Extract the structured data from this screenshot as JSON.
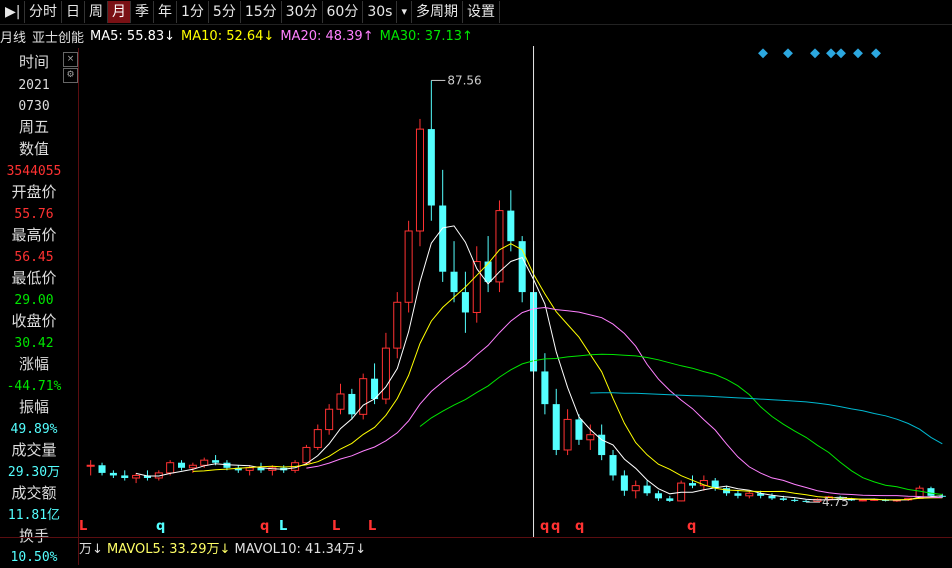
{
  "toolbar": {
    "icon_label": "▶|",
    "items": [
      "分时",
      "日",
      "周",
      "月",
      "季",
      "年",
      "1分",
      "5分",
      "15分",
      "30分",
      "60分",
      "30s",
      "▾",
      "多周期",
      "设置"
    ],
    "active": "月"
  },
  "info": {
    "period": "月线",
    "name": "亚士创能",
    "ma5": "MA5: 55.83↓",
    "ma10": "MA10: 52.64↓",
    "ma20": "MA20: 48.39↑",
    "ma30": "MA30: 37.13↑"
  },
  "sidebar": {
    "time_label": "时间",
    "year": "2021",
    "date": "0730",
    "weekday": "周五",
    "value_label": "数值",
    "value": "3544055",
    "open_label": "开盘价",
    "open": "55.76",
    "high_label": "最高价",
    "high": "56.45",
    "low_label": "最低价",
    "low": "29.00",
    "close_label": "收盘价",
    "close": "30.42",
    "change_label": "涨幅",
    "change": "-44.71%",
    "amplitude_label": "振幅",
    "amplitude": "49.89%",
    "volume_label": "成交量",
    "volume": "29.30万",
    "amount_label": "成交额",
    "amount": "11.81亿",
    "turnover_label": "换手",
    "turnover": "10.50%"
  },
  "annotations": {
    "high_price": "87.56",
    "low_price": "4.75"
  },
  "volume_bar": {
    "unit": "万↓",
    "mavol5": "MAVOL5: 33.29万↓",
    "mavol10": "MAVOL10: 41.34万↓"
  },
  "markers": [
    "L",
    "q",
    "q",
    "L",
    "L",
    "L",
    "q",
    "q",
    "q",
    "q"
  ],
  "colors": {
    "up": "#ff3232",
    "down": "#54ffff",
    "ma5": "#ffffff",
    "ma10": "#ffff00",
    "ma20": "#ff80ff",
    "ma30": "#00e600",
    "ma60": "#00b8d0",
    "accent": "#7a1014"
  },
  "chart_data": {
    "type": "candlestick",
    "period": "monthly",
    "ylim": [
      4,
      90
    ],
    "candles": [
      [
        12,
        13,
        10,
        12
      ],
      [
        12,
        12.5,
        10,
        10.5
      ],
      [
        10.5,
        11,
        9.5,
        10
      ],
      [
        10,
        11,
        9,
        9.5
      ],
      [
        9.5,
        10.5,
        8.5,
        10
      ],
      [
        10,
        11,
        9,
        9.5
      ],
      [
        9.5,
        11,
        9,
        10.5
      ],
      [
        10.5,
        13,
        10,
        12.5
      ],
      [
        12.5,
        13,
        11,
        11.5
      ],
      [
        11.5,
        12.5,
        10.5,
        12
      ],
      [
        12,
        13.5,
        11.5,
        13
      ],
      [
        13,
        14,
        12,
        12.5
      ],
      [
        12.5,
        13,
        11,
        11.5
      ],
      [
        11.5,
        12,
        10.5,
        11
      ],
      [
        11,
        12,
        10,
        11.5
      ],
      [
        11.5,
        12.5,
        10.5,
        11
      ],
      [
        11,
        12,
        10,
        11.5
      ],
      [
        11.5,
        12,
        10.5,
        11
      ],
      [
        11,
        13,
        10.5,
        12.5
      ],
      [
        12.5,
        16,
        12,
        15.5
      ],
      [
        15.5,
        20,
        15,
        19
      ],
      [
        19,
        24,
        18,
        23
      ],
      [
        23,
        28,
        22,
        26
      ],
      [
        26,
        27,
        21,
        22
      ],
      [
        22,
        30,
        21,
        29
      ],
      [
        29,
        32,
        24,
        25
      ],
      [
        25,
        38,
        24,
        35
      ],
      [
        35,
        46,
        33,
        44
      ],
      [
        44,
        60,
        42,
        58
      ],
      [
        58,
        80,
        55,
        78
      ],
      [
        78,
        87.56,
        60,
        63
      ],
      [
        63,
        70,
        48,
        50
      ],
      [
        50,
        56,
        44,
        46
      ],
      [
        46,
        50,
        38,
        42
      ],
      [
        42,
        55,
        40,
        52
      ],
      [
        52,
        57,
        46,
        48
      ],
      [
        48,
        64,
        46,
        62
      ],
      [
        62,
        66,
        54,
        56
      ],
      [
        56,
        57,
        44,
        46
      ],
      [
        46,
        56,
        29,
        30.42
      ],
      [
        30.42,
        34,
        22,
        24
      ],
      [
        24,
        27,
        14,
        15
      ],
      [
        15,
        23,
        14,
        21
      ],
      [
        21,
        22,
        16,
        17
      ],
      [
        17,
        20,
        15,
        18
      ],
      [
        18,
        20,
        13,
        14
      ],
      [
        14,
        15,
        9,
        10
      ],
      [
        10,
        11,
        6,
        7
      ],
      [
        7,
        9,
        5.5,
        8
      ],
      [
        8,
        9,
        6,
        6.5
      ],
      [
        6.5,
        7,
        5,
        5.5
      ],
      [
        5.5,
        6,
        4.8,
        5
      ],
      [
        5,
        9,
        4.9,
        8.5
      ],
      [
        8.5,
        10,
        7.5,
        8
      ],
      [
        8,
        10,
        7,
        9
      ],
      [
        9,
        9.5,
        7,
        7.5
      ],
      [
        7.5,
        8,
        6,
        6.5
      ],
      [
        6.5,
        7,
        5.5,
        6
      ],
      [
        6,
        7,
        5.5,
        6.5
      ],
      [
        6.5,
        7,
        5.5,
        6
      ],
      [
        6,
        6.5,
        5.2,
        5.5
      ],
      [
        5.5,
        6,
        5,
        5.2
      ],
      [
        5.2,
        5.5,
        4.8,
        5
      ],
      [
        5,
        5.2,
        4.75,
        4.9
      ],
      [
        4.9,
        5.5,
        4.8,
        5.3
      ],
      [
        5.3,
        6,
        5,
        5.8
      ],
      [
        5.8,
        6,
        5.2,
        5.4
      ],
      [
        5.4,
        5.6,
        5,
        5.1
      ],
      [
        5.1,
        5.4,
        4.9,
        5.2
      ],
      [
        5.2,
        5.5,
        5,
        5.3
      ],
      [
        5.3,
        5.4,
        4.9,
        5
      ],
      [
        5,
        5.3,
        4.8,
        5.2
      ],
      [
        5.2,
        5.6,
        5,
        5.5
      ],
      [
        5.5,
        8,
        5.4,
        7.5
      ],
      [
        7.5,
        7.8,
        5.8,
        6
      ],
      [
        6,
        6.4,
        5.6,
        5.9
      ]
    ]
  }
}
